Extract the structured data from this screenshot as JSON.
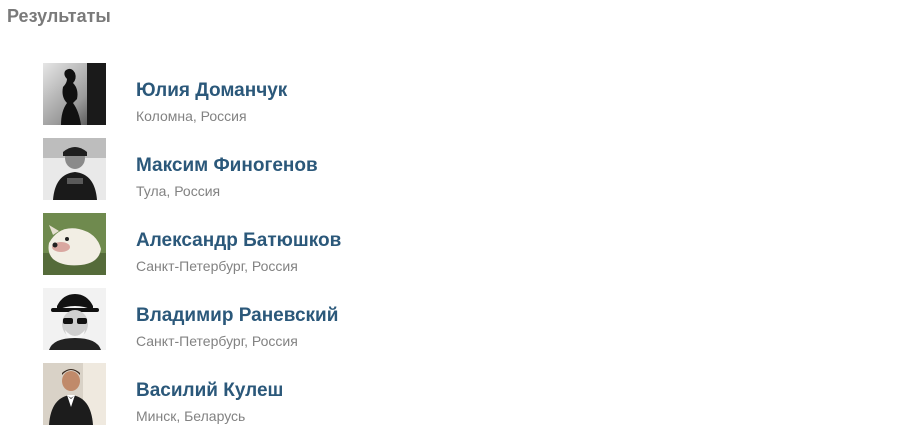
{
  "page": {
    "title": "Результаты"
  },
  "results": [
    {
      "name": "Юлия Доманчук",
      "location": "Коломна, Россия",
      "avatar_icon": "silhouette-photo"
    },
    {
      "name": "Максим Финогенов",
      "location": "Тула, Россия",
      "avatar_icon": "man-in-cap-photo"
    },
    {
      "name": "Александр Батюшков",
      "location": "Санкт-Петербург, Россия",
      "avatar_icon": "dog-photo"
    },
    {
      "name": "Владимир Раневский",
      "location": "Санкт-Петербург, Россия",
      "avatar_icon": "man-in-hat-photo"
    },
    {
      "name": "Василий Кулеш",
      "location": "Минск, Беларусь",
      "avatar_icon": "man-in-suit-photo"
    }
  ],
  "colors": {
    "name_link": "#2b587a",
    "location_text": "#828282",
    "title_text": "#7a7a7a"
  }
}
